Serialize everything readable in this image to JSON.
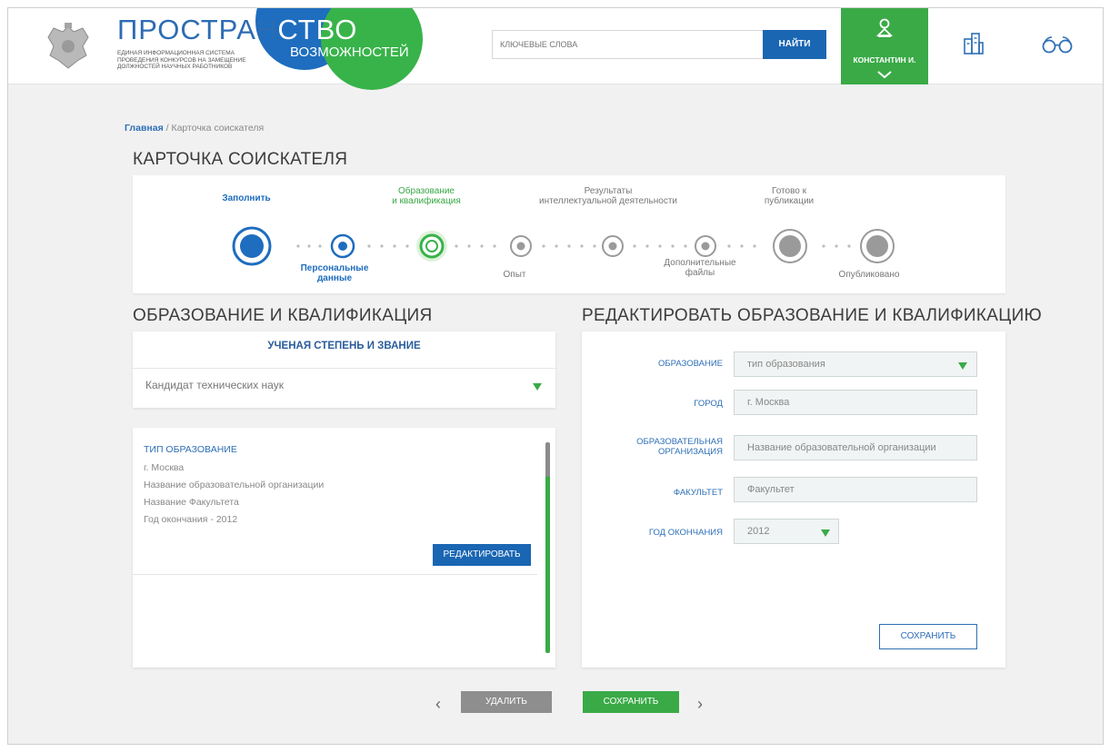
{
  "header": {
    "logo_main": "ПРОСТРАН",
    "logo_main_tail": "СТВО",
    "logo_sub_word": "ВОЗМОЖНОСТЕЙ",
    "logo_subtitle": "ЕДИНАЯ ИНФОРМАЦИОННАЯ СИСТЕМА ПРОВЕДЕНИЯ КОНКУРСОВ НА ЗАМЕЩЕНИЕ ДОЛЖНОСТЕЙ НАУЧНЫХ РАБОТНИКОВ",
    "search_placeholder": "КЛЮЧЕВЫЕ СЛОВА",
    "search_button": "НАЙТИ",
    "user_name": "КОНСТАНТИН И.",
    "colors": {
      "blue": "#1e6dbf",
      "green": "#38b34a"
    }
  },
  "breadcrumb": {
    "home": "Главная",
    "separator": " / ",
    "current": "Карточка соискателя"
  },
  "page_title": "КАРТОЧКА СОИСКАТЕЛЯ",
  "stepper": {
    "steps": [
      {
        "label": "Заполнить",
        "state": "done"
      },
      {
        "label": "Персональные\nданные",
        "state": "done"
      },
      {
        "label": "Образование\nи квалификация",
        "state": "current"
      },
      {
        "label": "Опыт",
        "state": "todo"
      },
      {
        "label": "Результаты\nинтеллектуальной деятельности",
        "state": "todo"
      },
      {
        "label": "Дополнительные\nфайлы",
        "state": "todo"
      },
      {
        "label": "Готово к\nпубликации",
        "state": "todo"
      },
      {
        "label": "Опубликовано",
        "state": "todo"
      }
    ]
  },
  "left": {
    "section_title": "ОБРАЗОВАНИЕ И КВАЛИФИКАЦИЯ",
    "degree": {
      "title": "УЧЕНАЯ СТЕПЕНЬ И ЗВАНИЕ",
      "value": "Кандидат технических наук"
    },
    "education": {
      "type": "ТИП ОБРАЗОВАНИЕ",
      "city": "г. Москва",
      "organization": "Название образовательной организации",
      "faculty": "Название Факультета",
      "year": "Год окончания - 2012",
      "edit_button": "РЕДАКТИРОВАТЬ"
    }
  },
  "right": {
    "section_title": "РЕДАКТИРОВАТЬ ОБРАЗОВАНИЕ И КВАЛИФИКАЦИЮ",
    "fields": {
      "education_label": "ОБРАЗОВАНИЕ",
      "education_value": "тип образования",
      "city_label": "ГОРОД",
      "city_value": "г. Москва",
      "org_label_1": "ОБРАЗОВАТЕЛЬНАЯ",
      "org_label_2": "ОРГАНИЗАЦИЯ",
      "org_value": "Название образовательной организации",
      "faculty_label": "ФАКУЛЬТЕТ",
      "faculty_value": "Факультет",
      "year_label": "ГОД ОКОНЧАНИЯ",
      "year_value": "2012"
    },
    "save_button": "СОХРАНИТЬ"
  },
  "bottom": {
    "prev": "‹",
    "delete_button": "УДАЛИТЬ",
    "save_button": "СОХРАНИТЬ",
    "next": "›"
  }
}
